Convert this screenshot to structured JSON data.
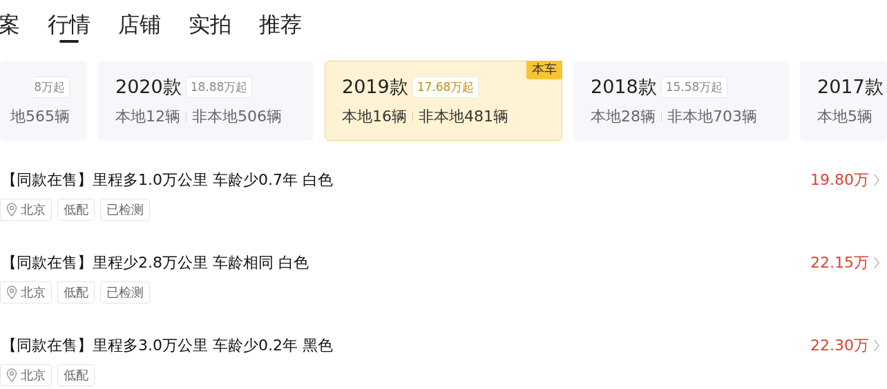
{
  "tabs": [
    {
      "label": "案",
      "selected": false
    },
    {
      "label": "行情",
      "selected": true
    },
    {
      "label": "店铺",
      "selected": false
    },
    {
      "label": "实拍",
      "selected": false
    },
    {
      "label": "推荐",
      "selected": false
    }
  ],
  "model_years": [
    {
      "price": "8万起",
      "counts": [
        "地565辆"
      ],
      "selected": false
    },
    {
      "year": "2020款",
      "price": "18.88万起",
      "counts": [
        "本地12辆",
        "非本地506辆"
      ],
      "selected": false
    },
    {
      "year": "2019款",
      "price": "17.68万起",
      "counts": [
        "本地16辆",
        "非本地481辆"
      ],
      "selected": true,
      "badge": "本车"
    },
    {
      "year": "2018款",
      "price": "15.58万起",
      "counts": [
        "本地28辆",
        "非本地703辆"
      ],
      "selected": false
    },
    {
      "year": "2017款",
      "counts": [
        "本地5辆"
      ],
      "selected": false
    }
  ],
  "listings": [
    {
      "title": "【同款在售】里程多1.0万公里 车龄少0.7年 白色",
      "price": "19.80万",
      "tags": [
        {
          "kind": "location",
          "label": "北京"
        },
        {
          "kind": "plain",
          "label": "低配"
        },
        {
          "kind": "plain",
          "label": "已检测"
        }
      ]
    },
    {
      "title": "【同款在售】里程少2.8万公里 车龄相同 白色",
      "price": "22.15万",
      "tags": [
        {
          "kind": "location",
          "label": "北京"
        },
        {
          "kind": "plain",
          "label": "低配"
        },
        {
          "kind": "plain",
          "label": "已检测"
        }
      ]
    },
    {
      "title": "【同款在售】里程多3.0万公里 车龄少0.2年 黑色",
      "price": "22.30万",
      "tags": [
        {
          "kind": "location",
          "label": "北京"
        },
        {
          "kind": "plain",
          "label": "低配"
        }
      ]
    }
  ]
}
